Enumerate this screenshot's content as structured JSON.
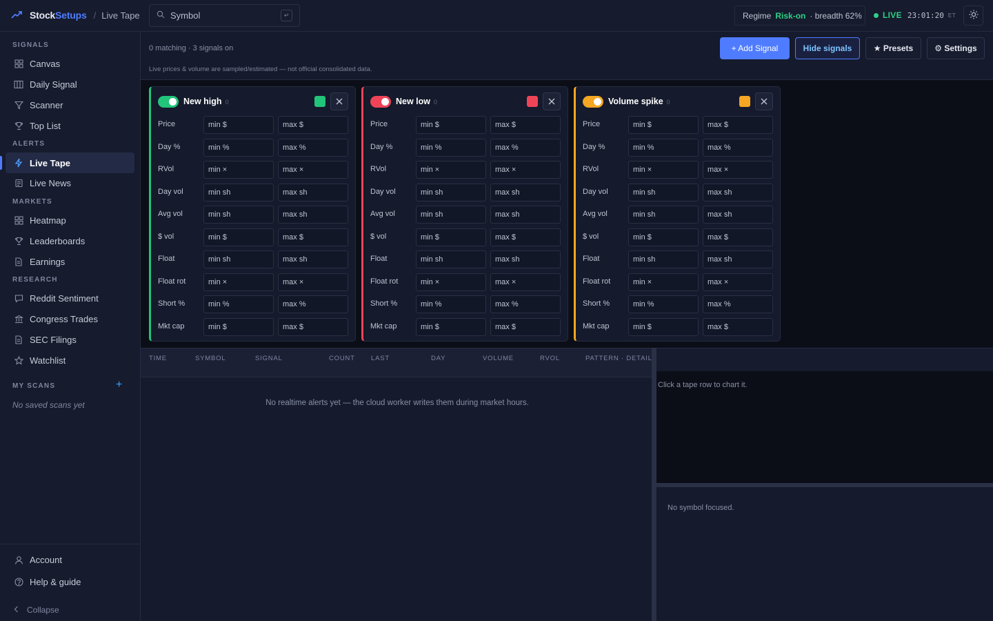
{
  "header": {
    "brand_part1": "Stock",
    "brand_part2": "Setups",
    "breadcrumb_sep": "/",
    "breadcrumb": "Live Tape",
    "search_placeholder": "Symbol",
    "search_kbd": "↵",
    "regime_label": "Regime",
    "regime_value": "Risk-on",
    "regime_breadth": "· breadth 62%",
    "live_label": "LIVE",
    "clock": "23:01:20",
    "timezone": "ET",
    "theme_icon": "sun-icon"
  },
  "sidebar": {
    "sections": [
      {
        "title": "SIGNALS",
        "items": [
          {
            "label": "Canvas",
            "icon": "grid-icon"
          },
          {
            "label": "Daily Signal",
            "icon": "columns-icon"
          },
          {
            "label": "Scanner",
            "icon": "filter-icon"
          },
          {
            "label": "Top List",
            "icon": "trophy-icon"
          }
        ]
      },
      {
        "title": "ALERTS",
        "items": [
          {
            "label": "Live Tape",
            "icon": "bolt-icon",
            "active": true
          },
          {
            "label": "Live News",
            "icon": "newspaper-icon"
          }
        ]
      },
      {
        "title": "MARKETS",
        "items": [
          {
            "label": "Heatmap",
            "icon": "grid-icon"
          },
          {
            "label": "Leaderboards",
            "icon": "trophy-icon"
          },
          {
            "label": "Earnings",
            "icon": "document-icon"
          }
        ]
      },
      {
        "title": "RESEARCH",
        "items": [
          {
            "label": "Reddit Sentiment",
            "icon": "chat-icon"
          },
          {
            "label": "Congress Trades",
            "icon": "building-icon"
          },
          {
            "label": "SEC Filings",
            "icon": "document-icon"
          },
          {
            "label": "Watchlist",
            "icon": "star-icon"
          }
        ]
      }
    ],
    "my_scans_title": "MY SCANS",
    "add_scan": "+",
    "my_scans_empty": "No saved scans yet",
    "bottom": [
      {
        "label": "Account",
        "icon": "user-icon"
      },
      {
        "label": "Help & guide",
        "icon": "help-icon"
      }
    ],
    "collapse_label": "Collapse"
  },
  "toolbar": {
    "matching": "0 matching · 3 signals on",
    "disclaimer": "Live prices & volume are sampled/estimated — not official consolidated data.",
    "add_signal": "+ Add Signal",
    "hide_signals": "Hide signals",
    "presets": "★ Presets",
    "settings": "⚙ Settings"
  },
  "cards": [
    {
      "title": "New high",
      "count": "0",
      "color": "#22c47a",
      "enabled": true
    },
    {
      "title": "New low",
      "count": "0",
      "color": "#ef4458",
      "enabled": true
    },
    {
      "title": "Volume spike",
      "count": "0",
      "color": "#f5a623",
      "enabled": true
    }
  ],
  "filter_rows": [
    {
      "label": "Price",
      "min": "min $",
      "max": "max $"
    },
    {
      "label": "Day %",
      "min": "min %",
      "max": "max %"
    },
    {
      "label": "RVol",
      "min": "min ×",
      "max": "max ×"
    },
    {
      "label": "Day vol",
      "min": "min sh",
      "max": "max sh"
    },
    {
      "label": "Avg vol",
      "min": "min sh",
      "max": "max sh"
    },
    {
      "label": "$ vol",
      "min": "min $",
      "max": "max $"
    },
    {
      "label": "Float",
      "min": "min sh",
      "max": "max sh"
    },
    {
      "label": "Float rot",
      "min": "min ×",
      "max": "max ×"
    },
    {
      "label": "Short %",
      "min": "min %",
      "max": "max %"
    },
    {
      "label": "Mkt cap",
      "min": "min $",
      "max": "max $"
    }
  ],
  "tape": {
    "columns": [
      "TIME",
      "SYMBOL",
      "SIGNAL",
      "COUNT",
      "LAST",
      "DAY",
      "VOLUME",
      "RVOL",
      "PATTERN · DETAIL"
    ],
    "empty": "No realtime alerts yet — the cloud worker writes them during market hours."
  },
  "chart_panel": {
    "hint": "Click a tape row to chart it."
  },
  "detail_panel": {
    "empty": "No symbol focused."
  }
}
